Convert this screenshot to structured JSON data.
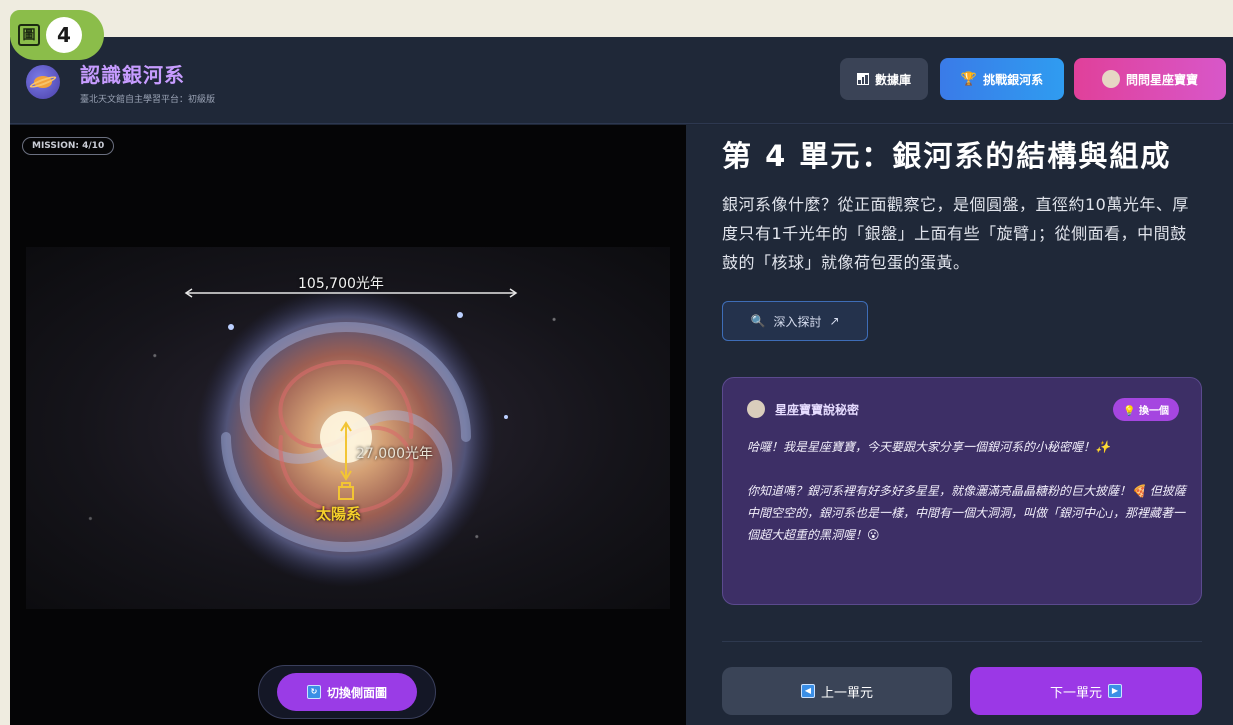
{
  "figure_badge": {
    "prefix": "圖",
    "number": "4"
  },
  "header": {
    "title": "認識銀河系",
    "subtitle": "臺北天文館自主學習平台：初級版",
    "buttons": {
      "database": "數據庫",
      "challenge": "挑戰銀河系",
      "ask": "問問星座寶寶"
    }
  },
  "left": {
    "mission": "MISSION: 4/10",
    "galaxy_labels": {
      "width": "105,700光年",
      "distance": "27,000光年",
      "sun": "太陽系"
    },
    "toggle_button": "切換側面圖"
  },
  "right": {
    "unit_title": "第 4 單元：銀河系的結構與組成",
    "description": "銀河系像什麼？從正面觀察它，是個圓盤，直徑約10萬光年、厚度只有1千光年的「銀盤」上面有些「旋臂」；從側面看，中間鼓鼓的「核球」就像荷包蛋的蛋黃。",
    "explore_button": "深入探討",
    "secret": {
      "title": "星座寶寶說秘密",
      "refresh": "換一個",
      "paragraph1": "哈囉！我是星座寶寶，今天要跟大家分享一個銀河系的小秘密喔！✨",
      "paragraph2": "你知道嗎？銀河系裡有好多好多星星，就像灑滿亮晶晶糖粉的巨大披薩！🍕 但披薩中間空空的，銀河系也是一樣，中間有一個大洞洞，叫做「銀河中心」，那裡藏著一個超大超重的黑洞喔！😮"
    },
    "nav": {
      "prev": "上一單元",
      "next": "下一單元"
    }
  },
  "colors": {
    "accent_purple": "#9b38e6",
    "challenge_blue": "#3a7be8",
    "ask_pink": "#e0409a",
    "sun_label": "#f5cf2b"
  }
}
